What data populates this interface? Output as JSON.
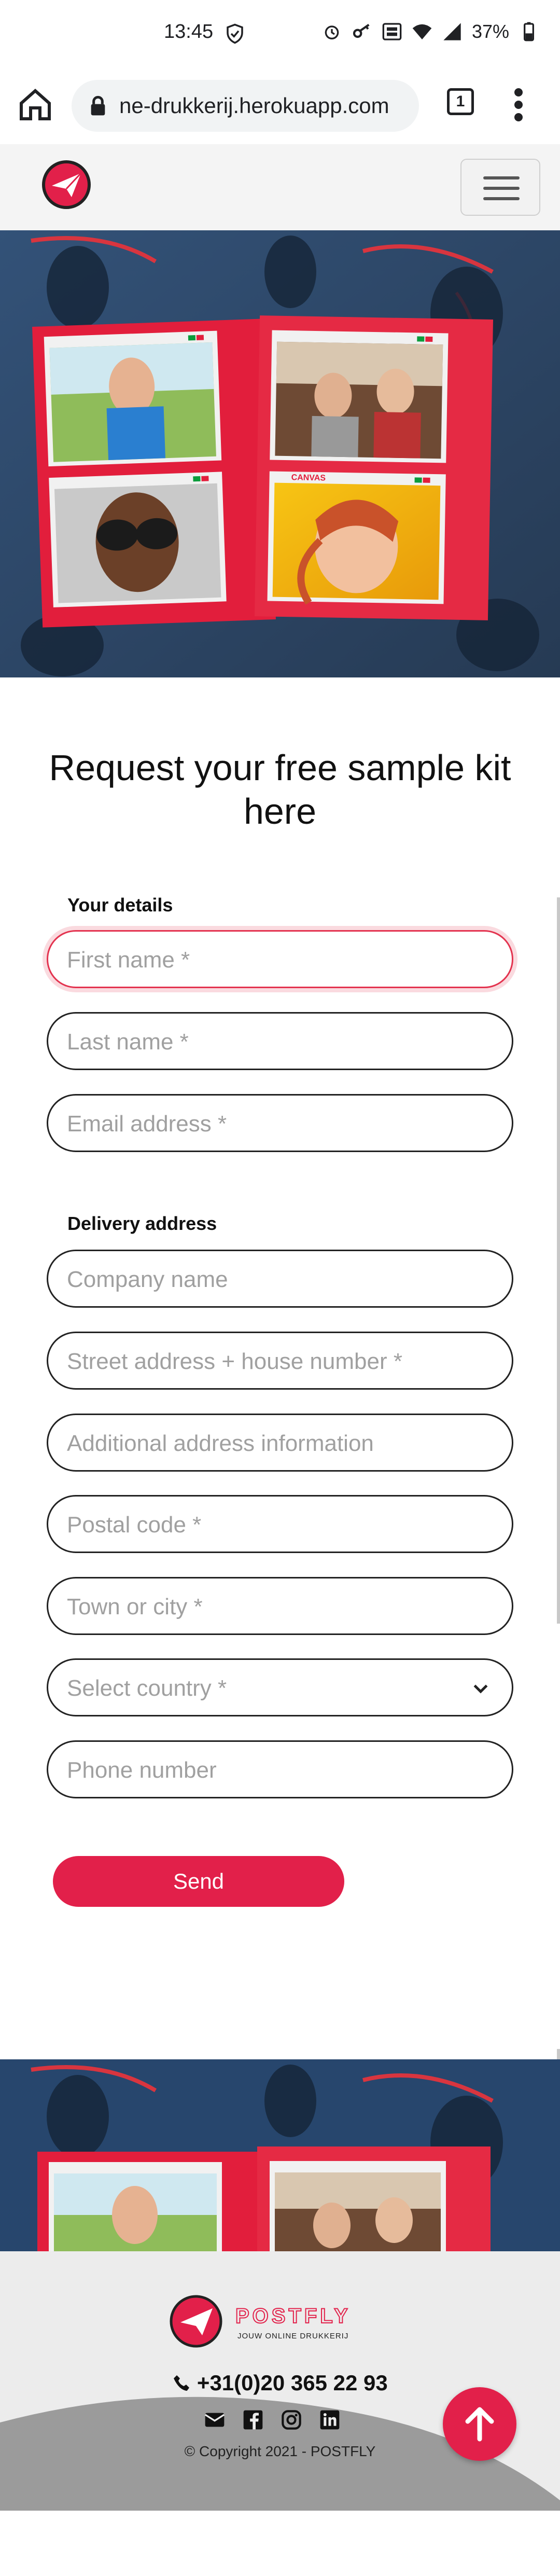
{
  "status_bar": {
    "time": "13:45",
    "battery": "37%"
  },
  "browser": {
    "url": "ne-drukkerij.herokuapp.com",
    "tab_count": "1"
  },
  "form": {
    "title": "Request your free sample kit here",
    "your_details_label": "Your details",
    "delivery_address_label": "Delivery address",
    "fields": {
      "first_name": "First name *",
      "last_name": "Last name *",
      "email": "Email address *",
      "company": "Company name",
      "street": "Street address + house number *",
      "additional": "Additional address information",
      "postal": "Postal code *",
      "town": "Town or city *",
      "country": "Select country *",
      "phone": "Phone number"
    },
    "send_label": "Send"
  },
  "hero": {
    "canvas_label": "CANVAS"
  },
  "footer": {
    "brand": "POSTFLY",
    "tagline": "JOUW ONLINE DRUKKERIJ",
    "phone": "+31(0)20 365 22 93",
    "copyright": "© Copyright 2021 - POSTFLY"
  },
  "colors": {
    "accent": "#e2204a",
    "text": "#111111",
    "footer_bg": "#ececec"
  }
}
